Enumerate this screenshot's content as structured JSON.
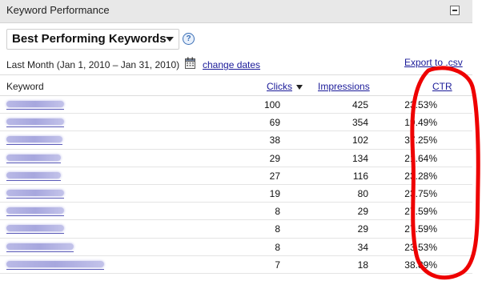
{
  "widget": {
    "title": "Keyword Performance",
    "report_selector": "Best Performing Keywords",
    "date_range_label": "Last Month (Jan 1, 2010 – Jan 31, 2010)",
    "change_dates_label": "change dates",
    "export_label": "Export to .csv"
  },
  "table": {
    "headers": {
      "keyword": "Keyword",
      "clicks": "Clicks",
      "impressions": "Impressions",
      "ctr": "CTR"
    },
    "rows": [
      {
        "clicks": "100",
        "impressions": "425",
        "ctr": "23.53%"
      },
      {
        "clicks": "69",
        "impressions": "354",
        "ctr": "19.49%"
      },
      {
        "clicks": "38",
        "impressions": "102",
        "ctr": "37.25%"
      },
      {
        "clicks": "29",
        "impressions": "134",
        "ctr": "21.64%"
      },
      {
        "clicks": "27",
        "impressions": "116",
        "ctr": "23.28%"
      },
      {
        "clicks": "19",
        "impressions": "80",
        "ctr": "23.75%"
      },
      {
        "clicks": "8",
        "impressions": "29",
        "ctr": "27.59%"
      },
      {
        "clicks": "8",
        "impressions": "29",
        "ctr": "27.59%"
      },
      {
        "clicks": "8",
        "impressions": "34",
        "ctr": "23.53%"
      },
      {
        "clicks": "7",
        "impressions": "18",
        "ctr": "38.89%"
      }
    ]
  },
  "icons": {
    "collapse": "minus-box-icon",
    "dropdown": "caret-down-icon",
    "help": "question-icon",
    "calendar": "calendar-icon",
    "sort": "sort-desc-icon"
  },
  "colors": {
    "link": "#1a1a99",
    "header_bg": "#e8e8e8",
    "annotation": "#ee0000"
  }
}
